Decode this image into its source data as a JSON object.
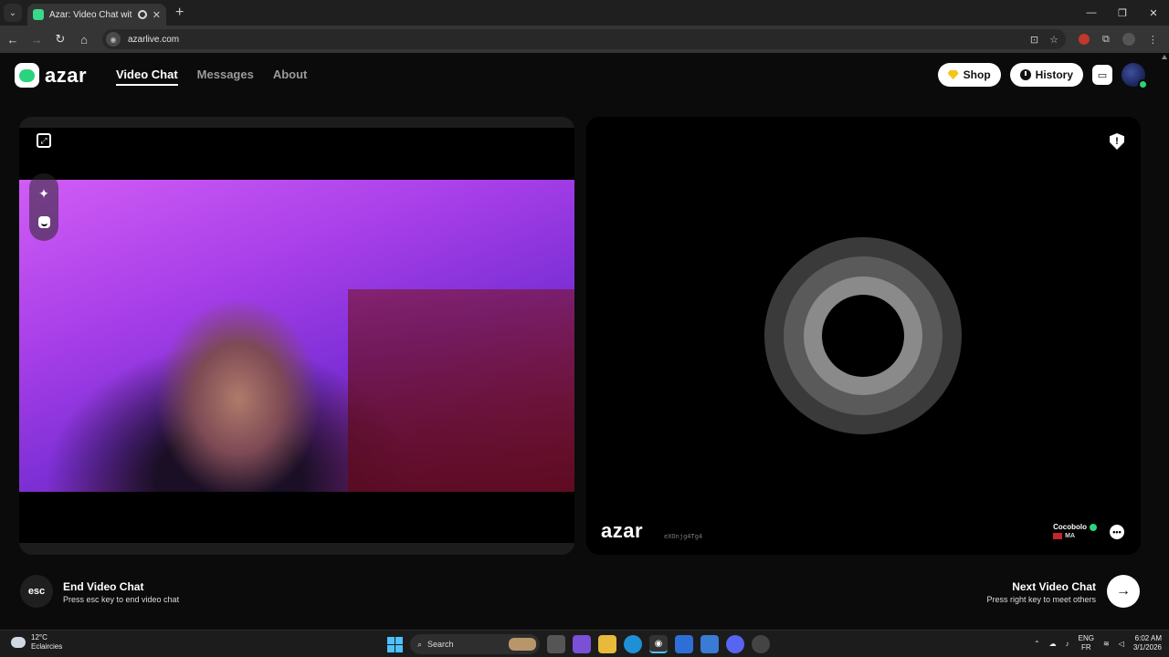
{
  "browser": {
    "tab_title": "Azar: Video Chat with New",
    "url": "azarlive.com"
  },
  "app": {
    "logo": "azar",
    "nav": [
      {
        "label": "Video Chat",
        "active": true
      },
      {
        "label": "Messages",
        "active": false
      },
      {
        "label": "About",
        "active": false
      }
    ],
    "shop_label": "Shop",
    "history_label": "History"
  },
  "remote": {
    "watermark_logo": "azar",
    "watermark_id": "eXOnjg4Tg4",
    "peer_name": "Cocobolo",
    "peer_country": "MA"
  },
  "actions": {
    "end_key": "esc",
    "end_title": "End Video Chat",
    "end_hint": "Press esc key to end video chat",
    "next_title": "Next Video Chat",
    "next_hint": "Press right key to meet others"
  },
  "taskbar": {
    "temperature": "12°C",
    "weather": "Eclaircies",
    "search_label": "Search",
    "lang_top": "ENG",
    "lang_bottom": "FR",
    "time": "6:02 AM",
    "date": "3/1/2026"
  },
  "colors": {
    "accent_green": "#2ad47c",
    "shop_gem": "#f5c518",
    "windows_blue": "#4cc2ff"
  },
  "icons": [
    "expand-icon",
    "magic-wand-icon",
    "sticker-icon",
    "report-shield-icon",
    "chat-bubble-icon",
    "arrow-right-icon",
    "clock-icon",
    "gem-icon",
    "inbox-icon"
  ]
}
